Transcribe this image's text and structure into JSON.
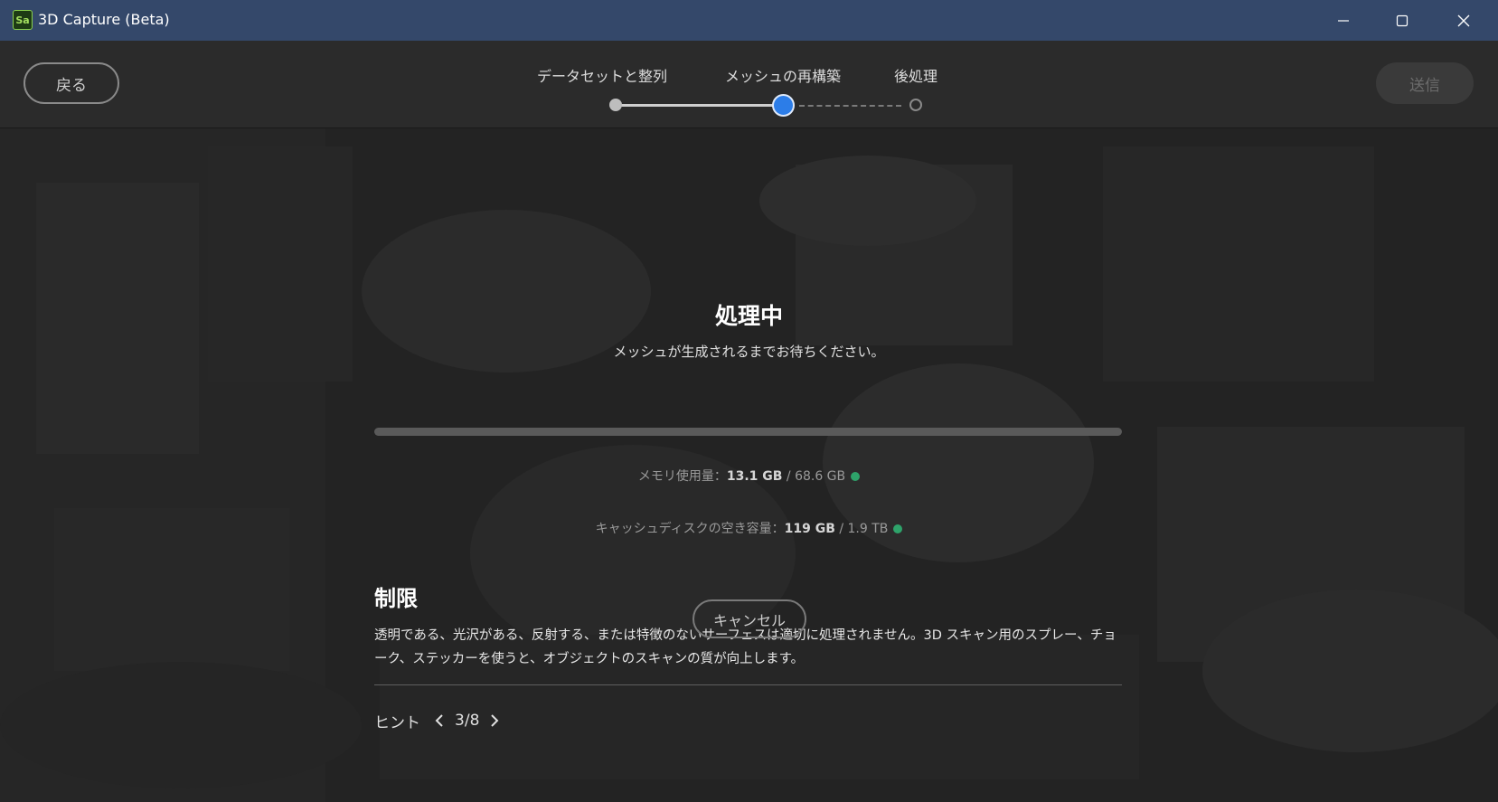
{
  "window": {
    "title": "3D Capture (Beta)",
    "app_icon_label": "Sa",
    "controls": [
      "minimize-icon",
      "maximize-icon",
      "close-icon"
    ]
  },
  "toolbar": {
    "back_label": "戻る",
    "send_label": "送信",
    "steps": [
      {
        "label": "データセットと整列",
        "state": "done"
      },
      {
        "label": "メッシュの再構築",
        "state": "current"
      },
      {
        "label": "後処理",
        "state": "pending"
      }
    ]
  },
  "processing": {
    "title": "処理中",
    "subtitle": "メッシュが生成されるまでお待ちください。",
    "progress_percent": 0
  },
  "stats": {
    "memory": {
      "label": "メモリ使用量：",
      "used": "13.1 GB",
      "separator": " / ",
      "total": "68.6 GB",
      "status_color": "#2ea36a"
    },
    "disk": {
      "label": "キャッシュディスクの空き容量：",
      "free": "119 GB",
      "separator": " / ",
      "total": "1.9 TB",
      "status_color": "#2ea36a"
    }
  },
  "hint": {
    "title": "制限",
    "text": "透明である、光沢がある、反射する、または特徴のないサーフェスは適切に処理されません。3D スキャン用のスプレー、チョーク、ステッカーを使うと、オブジェクトのスキャンの質が向上します。",
    "nav_label": "ヒント",
    "current": "3",
    "total": "8",
    "counter_sep": " / "
  },
  "cancel_label": "キャンセル",
  "colors": {
    "titlebar": "#34486a",
    "accent": "#2c7de8",
    "status_ok": "#2ea36a"
  }
}
